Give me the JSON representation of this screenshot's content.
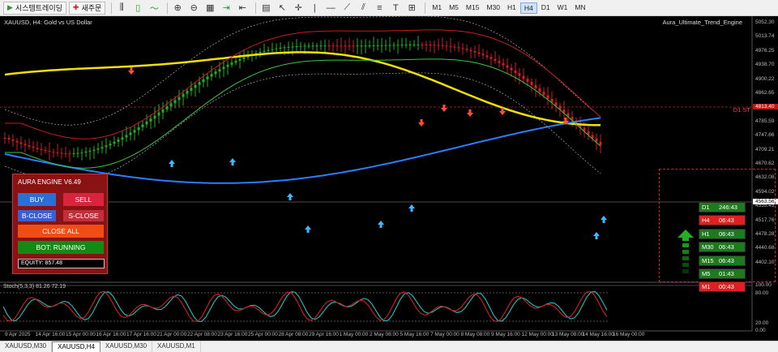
{
  "toolbar": {
    "trade_button": "시스템트레이딩",
    "new_order": "새주문",
    "timeframes": [
      "M1",
      "M5",
      "M15",
      "M30",
      "H1",
      "H4",
      "D1",
      "W1",
      "MN"
    ],
    "active_timeframe": "H4"
  },
  "chart": {
    "symbol_label": "XAUUSD, H4:  Gold vs US Dollar",
    "indicator_name": "Aura_Ultimate_Trend_Engine",
    "stoch_label": "Stoch(5,3,3) 81.26 72.19",
    "d1_tag": "D1 ST",
    "price_labels": [
      "5052.30",
      "5013.74",
      "4976.25",
      "4938.70",
      "4900.22",
      "4862.65",
      "4823.18",
      "4785.59",
      "4747.66",
      "4709.21",
      "4670.62",
      "4632.08",
      "4594.02",
      "4555.45",
      "4517.76",
      "4478.28",
      "4440.68",
      "4402.10"
    ],
    "current_price": "4563.56",
    "d1_price": "4813.40",
    "stoch_scale": [
      "100.00",
      "80.00",
      "20.00",
      "0.00"
    ],
    "dates": [
      "9 Apr 2025",
      "14 Apr 16:00",
      "15 Apr 00:00",
      "16 Apr 16:00",
      "17 Apr 16:00",
      "21 Apr 00:00",
      "22 Apr 08:00",
      "23 Apr 16:00",
      "25 Apr 00:00",
      "28 Apr 08:00",
      "29 Apr 16:00",
      "1 May 00:00",
      "2 May 08:00",
      "5 May 16:00",
      "7 May 00:00",
      "8 May 08:00",
      "9 May 16:00",
      "12 May 00:00",
      "13 May 08:00",
      "14 May 16:00",
      "16 May 00:00"
    ]
  },
  "panel": {
    "title": "AURA ENGINE V6.49",
    "buy": "BUY",
    "sell": "SELL",
    "b_close": "B-CLOSE",
    "s_close": "S-CLOSE",
    "close_all": "CLOSE ALL",
    "bot_status": "BOT: RUNNING",
    "equity": "EQUITY: 857.48"
  },
  "timeframe_table": [
    {
      "tf": "D1",
      "time": "246:43",
      "color": "#1e7a1e"
    },
    {
      "tf": "H4",
      "time": "06:43",
      "color": "#e02020"
    },
    {
      "tf": "H1",
      "time": "06:43",
      "color": "#1e7a1e"
    },
    {
      "tf": "M30",
      "time": "06:43",
      "color": "#1e7a1e"
    },
    {
      "tf": "M15",
      "time": "06:43",
      "color": "#1e7a1e"
    },
    {
      "tf": "M5",
      "time": "01:43",
      "color": "#1e7a1e"
    },
    {
      "tf": "M1",
      "time": "00:43",
      "color": "#e02020"
    }
  ],
  "tabs": [
    "XAUUSD,M30",
    "XAUUSD,H4",
    "XAUUSD,M30",
    "XAUUSD,M1"
  ],
  "active_tab": "XAUUSD,H4",
  "colors": {
    "yellow_ma": "#f2e100",
    "blue_ma": "#2a7fff",
    "bull": "#22b022",
    "bear": "#d02020",
    "stoch_main": "#20c0c0",
    "stoch_signal": "#d02020"
  }
}
